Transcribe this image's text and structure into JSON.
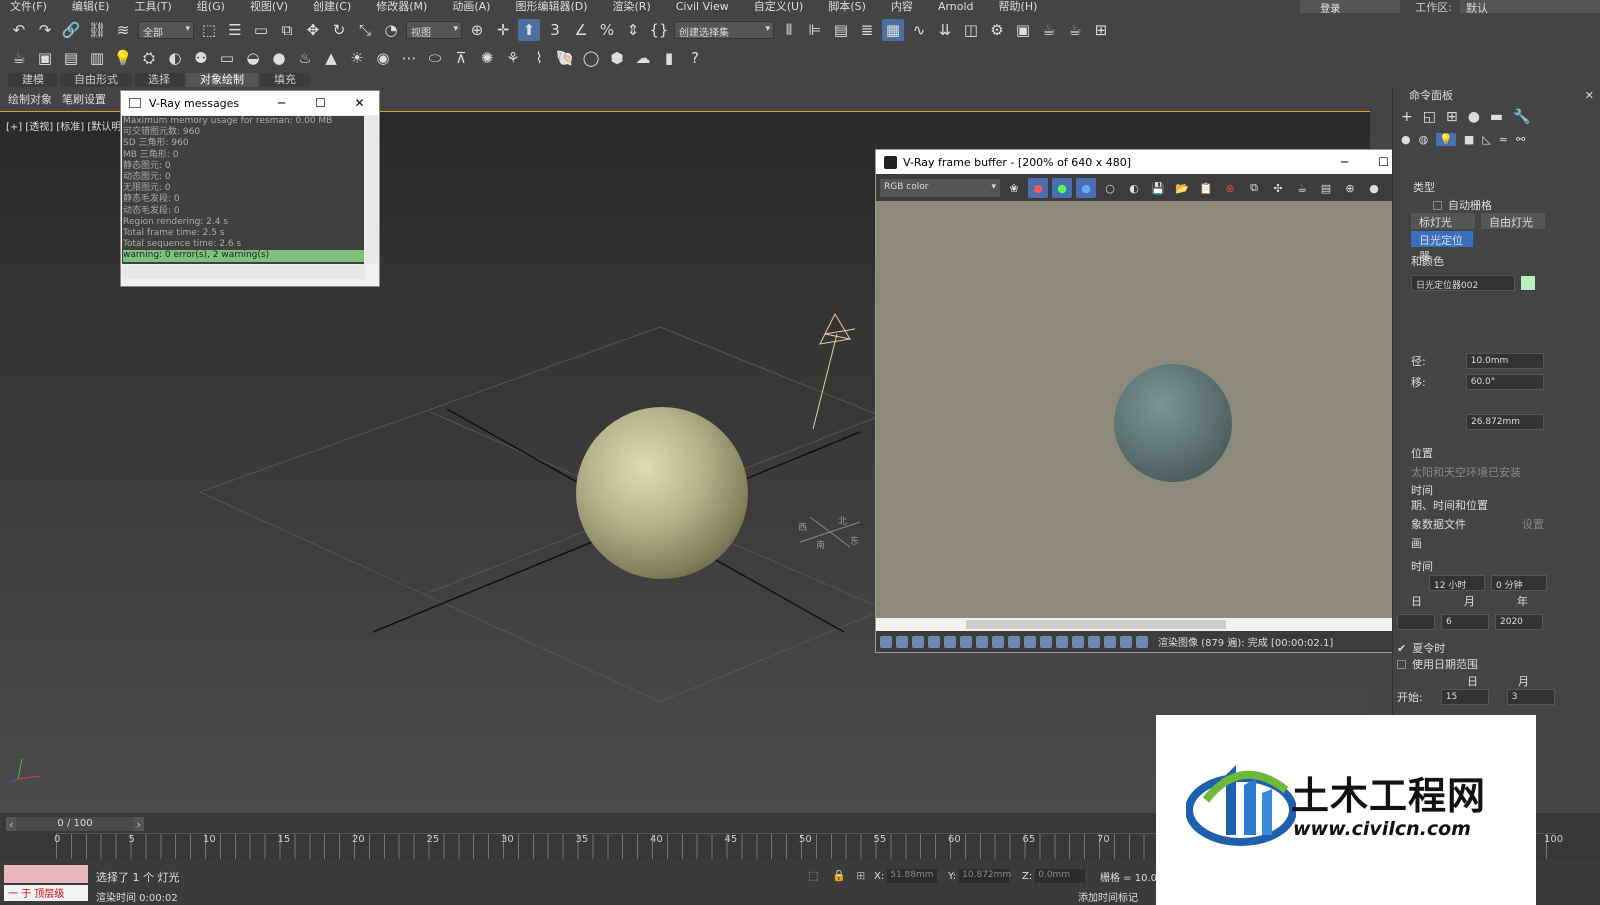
{
  "menu": [
    "文件(F)",
    "编辑(E)",
    "工具(T)",
    "组(G)",
    "视图(V)",
    "创建(C)",
    "修改器(M)",
    "动画(A)",
    "图形编辑器(D)",
    "渲染(R)",
    "Civil View",
    "自定义(U)",
    "脚本(S)",
    "内容",
    "Arnold",
    "帮助(H)"
  ],
  "topright": {
    "login": "登录",
    "workspace_label": "工作区:",
    "workspace_value": "默认"
  },
  "toolbar": {
    "filter": "全部",
    "refcoord": "视图",
    "named_sel": "创建选择集"
  },
  "ribbon_tabs": [
    "建模",
    "自由形式",
    "选择",
    "对象绘制",
    "填充"
  ],
  "ribbon_subtabs": [
    "绘制对象",
    "笔刷设置"
  ],
  "viewport": {
    "label": "[+] [透视] [标准] [默认明暗处理]",
    "compass": {
      "n": "北",
      "s": "南",
      "e": "东",
      "w": "西"
    }
  },
  "vray_messages": {
    "title": "V-Ray messages",
    "lines": [
      "Maximum memory usage for resman: 0.00 MB",
      "可交错图元数: 960",
      "SD 三角形: 960",
      "MB 三角形: 0",
      "静态图元: 0",
      "动态图元: 0",
      "无限图元: 0",
      "静态毛发段: 0",
      "动态毛发段: 0",
      "Region rendering: 2.4 s",
      "Total frame time: 2.5 s",
      "Total sequence time: 2.6 s"
    ],
    "warning": "warning: 0 error(s), 2 warning(s)",
    "separator": "================================"
  },
  "vfb": {
    "title": "V-Ray frame buffer - [200% of 640 x 480]",
    "channel": "RGB color",
    "status": "渲染图像 (879 遍): 完成 [00:00:02.1]"
  },
  "cmd_panel": {
    "title": "命令面板",
    "type_label": "类型",
    "auto_grid": "自动栅格",
    "btn_target": "标灯光",
    "btn_free": "自由灯光",
    "btn_daylight": "日光定位器",
    "name_color": "和颜色",
    "object_name": "日光定位器002",
    "f_radius_lbl": "径:",
    "f_radius": "10.0mm",
    "f_offset_lbl": "移:",
    "f_offset": "60.0°",
    "f_dist": "26.872mm",
    "pos_label": "位置",
    "sun_sky": "太阳和天空环境已安装",
    "time_label": "时间",
    "date_time_pos": "期、时间和位置",
    "weather_file": "象数据文件",
    "settings": "设置",
    "anim": "画",
    "time2": "时间",
    "hours": "12 小时",
    "minutes": "0 分钟",
    "day": "日",
    "month": "月",
    "year": "年",
    "d_val": "",
    "m_val": "6",
    "y_val": "2020",
    "dst": "夏令时",
    "use_date_range": "使用日期范围",
    "day2": "日",
    "month2": "月",
    "start_lbl": "开始:",
    "start_day": "15",
    "start_month": "3"
  },
  "timeline": {
    "frame": "0 / 100",
    "ticks": [
      "0",
      "5",
      "10",
      "15",
      "20",
      "25",
      "30",
      "35",
      "40",
      "45",
      "50",
      "55",
      "60",
      "65",
      "70",
      "100"
    ]
  },
  "status": {
    "layer": "一 于 顶层级",
    "selected": "选择了 1 个 灯光",
    "render_time": "渲染时间  0:00:02",
    "x": "51.88mm",
    "y": "10.872mm",
    "z": "0.0mm",
    "grid": "栅格 = 10.0",
    "add_time": "添加时间标记"
  },
  "watermark": {
    "brand": "土木工程网",
    "url": "www.civilcn.com"
  }
}
